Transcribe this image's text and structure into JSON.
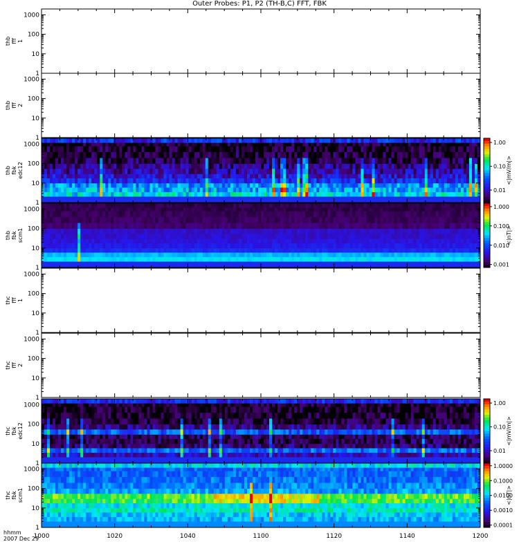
{
  "header": {
    "title": "Outer Probes: P1, P2 (TH-B,C) FFT, FBK"
  },
  "footer": {
    "time_label": "hhmm",
    "date_label": "2007 Dec 29"
  },
  "colors": {
    "frame": "#000000",
    "background": "#ffffff"
  },
  "chart_data": {
    "type": "heatmap",
    "x_axis": {
      "ticks": [
        "1000",
        "1020",
        "1040",
        "1100",
        "1120",
        "1140",
        "1200"
      ],
      "range": [
        "10:00",
        "12:00"
      ],
      "units": "hhmm"
    },
    "y_axis": {
      "scale": "log",
      "range": [
        1,
        2000
      ],
      "ticks": [
        "1",
        "10",
        "100",
        "1000"
      ]
    },
    "panels": [
      {
        "label": [
          "thb",
          "fff",
          "1"
        ],
        "kind": "empty"
      },
      {
        "label": [
          "thb",
          "fff",
          "2"
        ],
        "kind": "empty"
      },
      {
        "label": [
          "thb",
          "fbk",
          "edc12"
        ],
        "kind": "spectrogram",
        "colorbar_units": "<|mV/m|>",
        "colorbar_ticks": [
          "1.00",
          "0.10",
          "0.01"
        ],
        "colorbar_range": [
          0.003,
          1.5
        ],
        "colorbar_scale": "log"
      },
      {
        "label": [
          "thb",
          "fbk",
          "scm1"
        ],
        "kind": "spectrogram",
        "colorbar_units": "<|nT|>",
        "colorbar_ticks": [
          "1.000",
          "0.100",
          "0.010",
          "0.001"
        ],
        "colorbar_range": [
          0.0007,
          1.5
        ],
        "colorbar_scale": "log"
      },
      {
        "label": [
          "thc",
          "fff",
          "1"
        ],
        "kind": "empty"
      },
      {
        "label": [
          "thc",
          "fff",
          "2"
        ],
        "kind": "empty"
      },
      {
        "label": [
          "thc",
          "fbk",
          "edc12"
        ],
        "kind": "spectrogram",
        "colorbar_units": "<|mV/m|>",
        "colorbar_ticks": [
          "1.00",
          "0.10",
          "0.01"
        ],
        "colorbar_range": [
          0.003,
          1.5
        ],
        "colorbar_scale": "log"
      },
      {
        "label": [
          "thc",
          "fbk",
          "scm1"
        ],
        "kind": "spectrogram",
        "colorbar_units": "<|nT|>",
        "colorbar_ticks": [
          "1.0000",
          "0.1000",
          "0.0100",
          "0.0010",
          "0.0001"
        ],
        "colorbar_range": [
          7e-05,
          1.5
        ],
        "colorbar_scale": "log"
      }
    ]
  }
}
